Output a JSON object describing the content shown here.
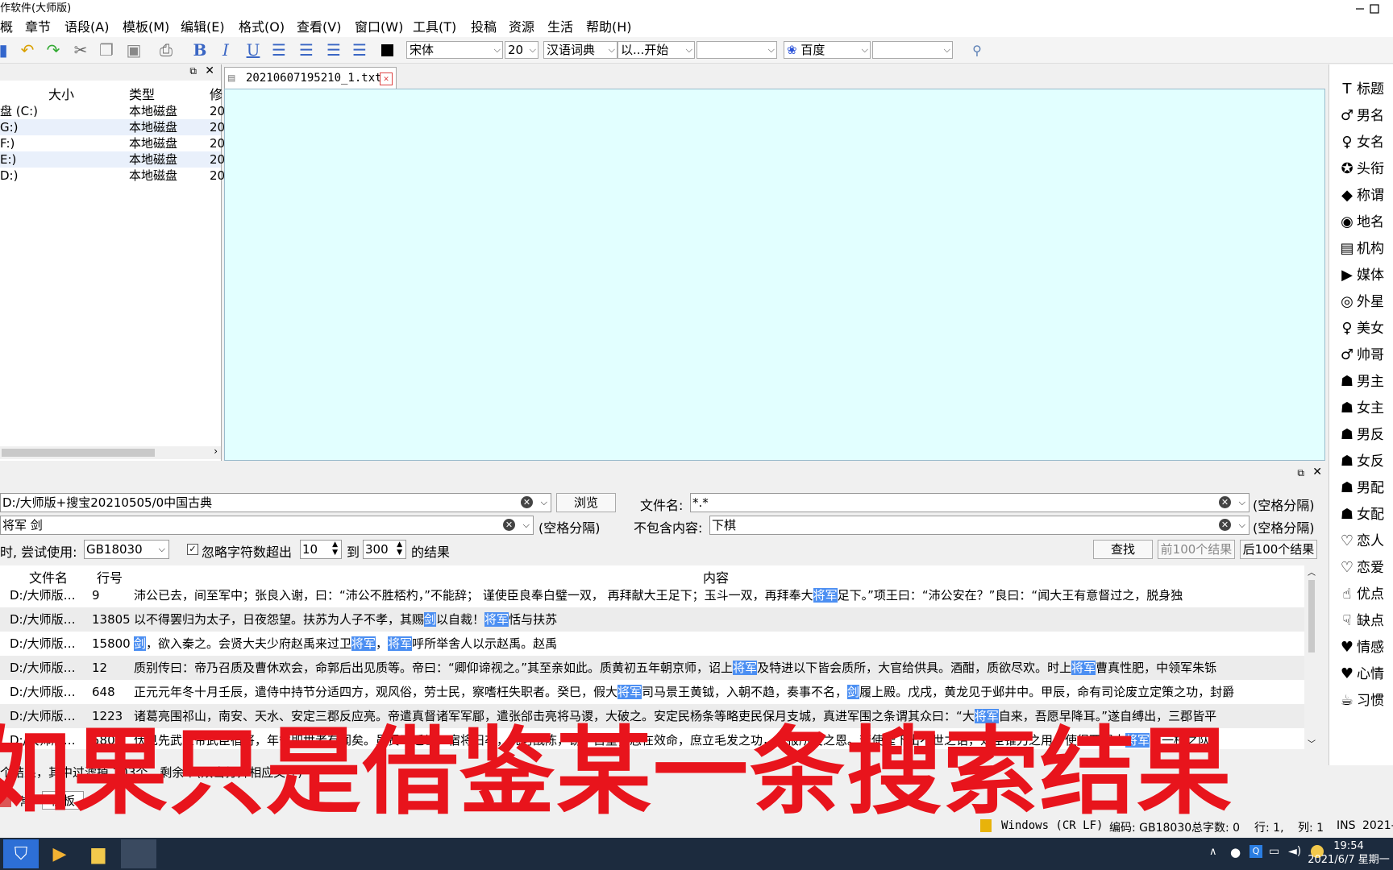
{
  "window": {
    "title": "作软件(大师版)"
  },
  "menu": [
    "概",
    "章节",
    "语段(A)",
    "模板(M)",
    "编辑(E)",
    "格式(O)",
    "查看(V)",
    "窗口(W)",
    "工具(T)",
    "投稿",
    "资源",
    "生活",
    "帮助(H)"
  ],
  "toolbar": {
    "font_name": "宋体",
    "font_size": "20",
    "dictionary": "汉语词典",
    "match_mode": "以...开始",
    "search_engine": "百度",
    "color_swatch": "#000000"
  },
  "left_panel": {
    "columns": [
      "大小",
      "类型",
      "修"
    ],
    "rows": [
      {
        "name": "盘 (C:)",
        "type": "本地磁盘",
        "mod": "20"
      },
      {
        "name": "G:)",
        "type": "本地磁盘",
        "mod": "20"
      },
      {
        "name": "F:)",
        "type": "本地磁盘",
        "mod": "20"
      },
      {
        "name": "E:)",
        "type": "本地磁盘",
        "mod": "20"
      },
      {
        "name": "D:)",
        "type": "本地磁盘",
        "mod": "20"
      }
    ]
  },
  "editor": {
    "tab_label": "20210607195210_1.txt",
    "background": "#e2ffff"
  },
  "right_panel": {
    "items": [
      {
        "icon": "title-icon",
        "glyph": "T",
        "label": "标题"
      },
      {
        "icon": "male-name-icon",
        "glyph": "♂",
        "label": "男名"
      },
      {
        "icon": "female-name-icon",
        "glyph": "♀",
        "label": "女名"
      },
      {
        "icon": "rank-icon",
        "glyph": "✪",
        "label": "头衔"
      },
      {
        "icon": "tag-icon",
        "glyph": "◆",
        "label": "称谓"
      },
      {
        "icon": "place-icon",
        "glyph": "◉",
        "label": "地名"
      },
      {
        "icon": "org-icon",
        "glyph": "▤",
        "label": "机构"
      },
      {
        "icon": "media-icon",
        "glyph": "▶",
        "label": "媒体"
      },
      {
        "icon": "alien-icon",
        "glyph": "◎",
        "label": "外星"
      },
      {
        "icon": "beauty-icon",
        "glyph": "♀",
        "label": "美女"
      },
      {
        "icon": "handsome-icon",
        "glyph": "♂",
        "label": "帅哥"
      },
      {
        "icon": "male-lead-icon",
        "glyph": "☗",
        "label": "男主"
      },
      {
        "icon": "female-lead-icon",
        "glyph": "☗",
        "label": "女主"
      },
      {
        "icon": "male-villain-icon",
        "glyph": "☗",
        "label": "男反"
      },
      {
        "icon": "female-villain-icon",
        "glyph": "☗",
        "label": "女反"
      },
      {
        "icon": "male-support-icon",
        "glyph": "☗",
        "label": "男配"
      },
      {
        "icon": "female-support-icon",
        "glyph": "☗",
        "label": "女配"
      },
      {
        "icon": "lover-icon",
        "glyph": "♡",
        "label": "恋人"
      },
      {
        "icon": "love-icon",
        "glyph": "♡",
        "label": "恋爱"
      },
      {
        "icon": "thumbs-up-icon",
        "glyph": "☝",
        "label": "优点"
      },
      {
        "icon": "thumbs-down-icon",
        "glyph": "☟",
        "label": "缺点"
      },
      {
        "icon": "emotion-icon",
        "glyph": "♥",
        "label": "情感"
      },
      {
        "icon": "heart-icon",
        "glyph": "♥",
        "label": "心情"
      },
      {
        "icon": "cup-icon",
        "glyph": "☕",
        "label": "习惯"
      }
    ]
  },
  "search": {
    "path": "D:/大师版+搜宝20210505/0中国古典",
    "browse_label": "浏览",
    "filename_label": "文件名:",
    "filename_value": "*.*",
    "space_sep_label": "(空格分隔)",
    "keywords": "将军 剑",
    "exclude_label": "不包含内容:",
    "exclude_value": "下棋",
    "encoding_prefix": "时, 尝试使用:",
    "encoding": "GB18030",
    "ignore_label": "忽略字符数超出",
    "range_from": "10",
    "range_to_label": "到",
    "range_to": "300",
    "range_suffix": "的结果",
    "find_label": "查找",
    "prev_label": "前100个结果",
    "next_label": "后100个结果",
    "columns": {
      "file": "文件名",
      "line": "行号",
      "content": "内容"
    },
    "results": [
      {
        "file": "D:/大师版…",
        "line": "9",
        "segments": [
          {
            "t": "沛公已去，间至军中；张良入谢，曰：“沛公不胜桮杓，”不能辞； 谨使臣良奉白璧一双， 再拜献大王足下；玉斗一双，再拜奉大",
            "h": false
          },
          {
            "t": "将军",
            "h": true
          },
          {
            "t": "足下。”项王曰：“沛公安在？”良曰：“闻大王有意督过之，脱身独",
            "h": false
          }
        ]
      },
      {
        "file": "D:/大师版…",
        "line": "13805",
        "segments": [
          {
            "t": "以不得罢归为太子，日夜怨望。扶苏为人子不孝，其赐",
            "h": false
          },
          {
            "t": "剑",
            "h": true
          },
          {
            "t": "以自裁！",
            "h": false
          },
          {
            "t": "将军",
            "h": true
          },
          {
            "t": "恬与扶苏",
            "h": false
          }
        ]
      },
      {
        "file": "D:/大师版…",
        "line": "15800",
        "segments": [
          {
            "t": "剑",
            "h": true
          },
          {
            "t": "，欲入秦之。会贤大夫少府赵禹来过卫",
            "h": false
          },
          {
            "t": "将军",
            "h": true
          },
          {
            "t": "，",
            "h": false
          },
          {
            "t": "将军",
            "h": true
          },
          {
            "t": "呼所举舍人以示赵禹。赵禹",
            "h": false
          }
        ]
      },
      {
        "file": "D:/大师版…",
        "line": "12",
        "segments": [
          {
            "t": "质别传曰：帝乃召质及曹休欢会，命郭后出见质等。帝曰：“卿仰谛视之。”其至亲如此。质黄初五年朝京师，诏上",
            "h": false
          },
          {
            "t": "将军",
            "h": true
          },
          {
            "t": "及特进以下皆会质所，大官给供具。酒酣，质欲尽欢。时上",
            "h": false
          },
          {
            "t": "将军",
            "h": true
          },
          {
            "t": "曹真性肥，中领军朱铄",
            "h": false
          }
        ]
      },
      {
        "file": "D:/大师版…",
        "line": "648",
        "segments": [
          {
            "t": "正元元年冬十月壬辰，遣侍中持节分适四方，观风俗，劳士民，察嗜枉失职者。癸巳，假大",
            "h": false
          },
          {
            "t": "将军",
            "h": true
          },
          {
            "t": "司马景王黄钺，入朝不趋，奏事不名，",
            "h": false
          },
          {
            "t": "剑",
            "h": true
          },
          {
            "t": "履上殿。戊戌，黄龙见于邺井中。甲辰，命有司论废立定策之功，封爵",
            "h": false
          }
        ]
      },
      {
        "file": "D:/大师版…",
        "line": "1223",
        "segments": [
          {
            "t": "诸葛亮围祁山，南安、天水、安定三郡反应亮。帝遣真督诸军军郿，遣张郃击亮将马谡，大破之。安定民杨条等略吏民保月支城，真进军围之条谓其众曰：“大",
            "h": false
          },
          {
            "t": "将军",
            "h": true
          },
          {
            "t": "自来，吾愿早降耳。”遂自缚出，三郡皆平",
            "h": false
          }
        ]
      },
      {
        "file": "D:/大师版…",
        "line": "580",
        "segments": [
          {
            "t": "伏见先武皇帝武臣宿将，年耆即世者有闻矣。虽贤不乏世，宿将旧卒，犹习战陈，窃不自量，志在效命，庶立毛发之功，以报所受之恩。若使陛下出不世之诏，效臣锥刀之用，使得西属大",
            "h": false
          },
          {
            "t": "将军",
            "h": true
          },
          {
            "t": "当一校之队",
            "h": false
          }
        ]
      }
    ],
    "summary": "个结果，其中过滤掉 203个，剩余个(双击打开相应文件)"
  },
  "bottom_tabs": [
    "常",
    "模板"
  ],
  "caption": "如果只是借鉴某一条搜索结果",
  "statusbar": {
    "line_ending": "Windows (CR LF)",
    "encoding": "编码: GB18030",
    "char_count": "总字数: 0",
    "row": "行: 1,",
    "col": "列: 1",
    "ins": "INS",
    "date": "2021-"
  },
  "taskbar": {
    "time": "19:54",
    "date": "2021/6/7 星期一"
  }
}
